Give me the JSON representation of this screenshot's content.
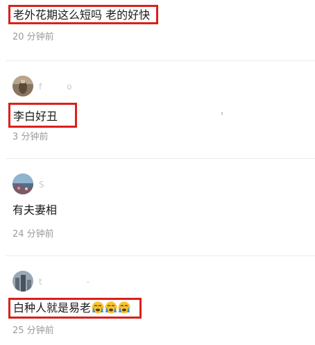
{
  "comments": [
    {
      "text": "老外花期这么短吗 老的好快",
      "time": "20 分钟前",
      "highlighted": true
    },
    {
      "avatar": "avatar-photo-1",
      "username": "f",
      "username_tail": "o",
      "text": "李白好丑",
      "time": "3 分钟前",
      "highlighted": true
    },
    {
      "avatar": "avatar-photo-2",
      "username": "S",
      "text": "有夫妻相",
      "time": "24 分钟前",
      "highlighted": false
    },
    {
      "avatar": "avatar-photo-3",
      "username": "t",
      "username_tail": "-",
      "text": "白种人就是易老",
      "emojis": [
        "crying-face-icon",
        "crying-face-icon",
        "crying-face-icon"
      ],
      "time": "25 分钟前",
      "highlighted": true
    }
  ],
  "colors": {
    "highlight_border": "#d9201b",
    "timestamp": "#9b9b9b",
    "divider": "#ececec",
    "emoji_face": "#f7c431",
    "emoji_tears": "#3b8fd9"
  }
}
